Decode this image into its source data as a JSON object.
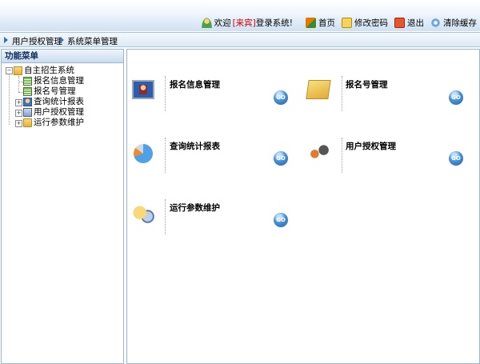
{
  "topnav": {
    "welcome_prefix": "欢迎",
    "guest_label": "[来宾]",
    "welcome_suffix": "登录系统!",
    "home": "首页",
    "change_password": "修改密码",
    "logout": "退出",
    "clear_cache": "清除缓存"
  },
  "breadcrumb": {
    "items": [
      "用户授权管理",
      "系统菜单管理"
    ]
  },
  "sidebar": {
    "title": "功能菜单",
    "root": "自主招生系统",
    "items": [
      "报名信息管理",
      "报名号管理",
      "查询统计报表",
      "用户授权管理",
      "运行参数维护"
    ]
  },
  "main": {
    "tiles": [
      {
        "title": "报名信息管理",
        "icon": "monitor-user-icon"
      },
      {
        "title": "报名号管理",
        "icon": "folder-cards-icon"
      },
      {
        "title": "查询统计报表",
        "icon": "pie-chart-icon"
      },
      {
        "title": "用户授权管理",
        "icon": "users-icon"
      },
      {
        "title": "运行参数维护",
        "icon": "settings-folder-icon"
      }
    ],
    "go_label": "GO"
  }
}
